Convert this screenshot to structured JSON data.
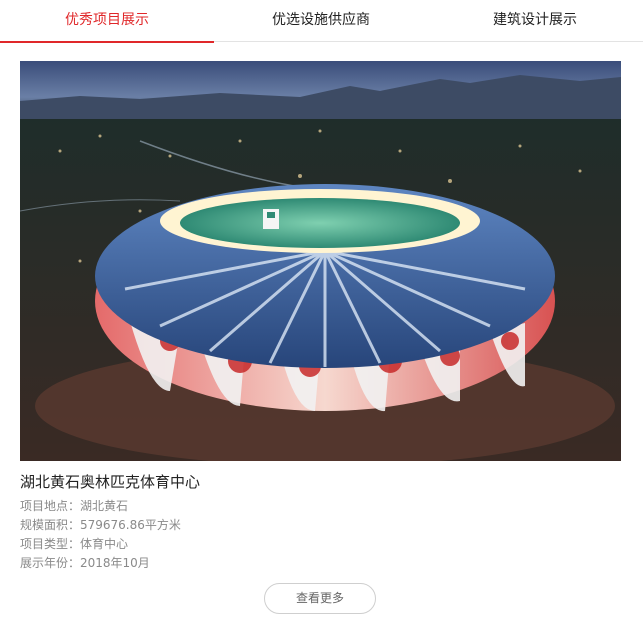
{
  "tabs": [
    {
      "label": "优秀项目展示",
      "active": true
    },
    {
      "label": "优选设施供应商",
      "active": false
    },
    {
      "label": "建筑设计展示",
      "active": false
    }
  ],
  "accent_color": "#e0282a",
  "project": {
    "image_subject": "stadium-aerial-photo",
    "title": "湖北黄石奥林匹克体育中心",
    "location": "项目地点：湖北黄石",
    "area": "规模面积：579676.86平方米",
    "type": "项目类型：体育中心",
    "year": "展示年份：2018年10月"
  },
  "more_button": "查看更多"
}
